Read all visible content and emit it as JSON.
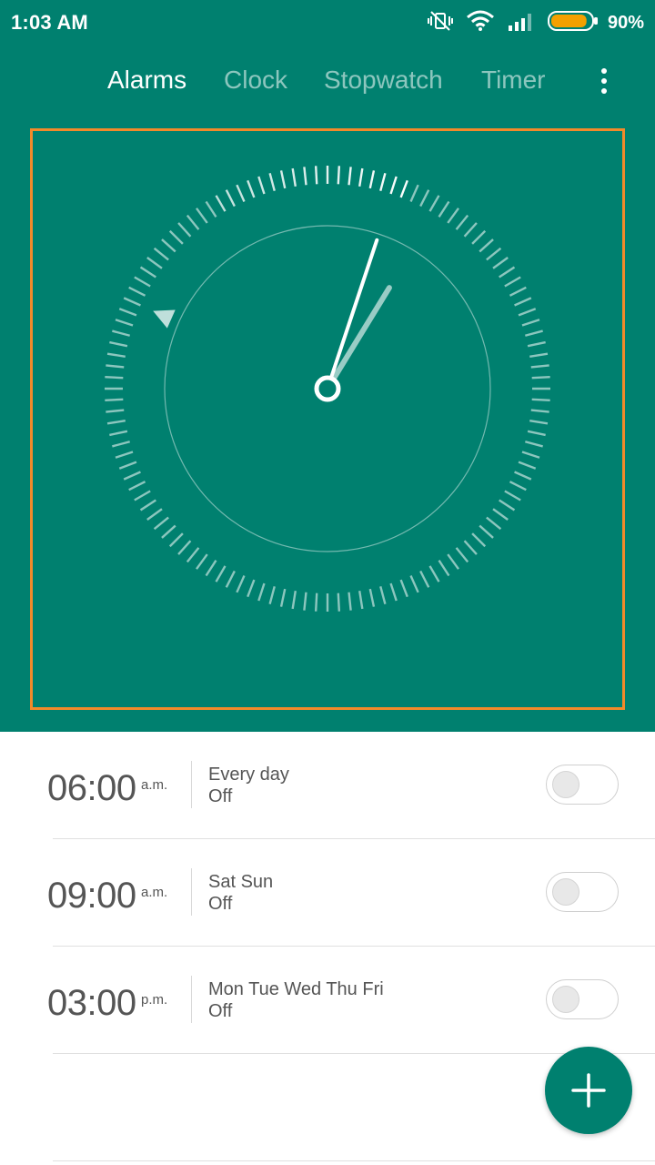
{
  "status_bar": {
    "time": "1:03 AM",
    "battery_percent_text": "90%",
    "icons": [
      "vibrate-off-icon",
      "wifi-icon",
      "signal-icon",
      "battery-icon"
    ],
    "battery_level": 0.9,
    "battery_color": "#F4A000"
  },
  "tabs": [
    {
      "label": "Alarms",
      "active": true
    },
    {
      "label": "Clock",
      "active": false
    },
    {
      "label": "Stopwatch",
      "active": false
    },
    {
      "label": "Timer",
      "active": false
    }
  ],
  "menu": {
    "icon": "more-vert-icon"
  },
  "clock": {
    "hour": 1,
    "minute": 3,
    "second": 4,
    "highlight_color": "#F28A2A",
    "accent_color": "#00806F"
  },
  "alarms": [
    {
      "time": "06:00",
      "period": "a.m.",
      "days": "Every day",
      "state": "Off",
      "enabled": false
    },
    {
      "time": "09:00",
      "period": "a.m.",
      "days": "Sat Sun",
      "state": "Off",
      "enabled": false
    },
    {
      "time": "03:00",
      "period": "p.m.",
      "days": "Mon Tue Wed Thu Fri",
      "state": "Off",
      "enabled": false
    }
  ],
  "fab": {
    "icon": "plus-icon"
  }
}
